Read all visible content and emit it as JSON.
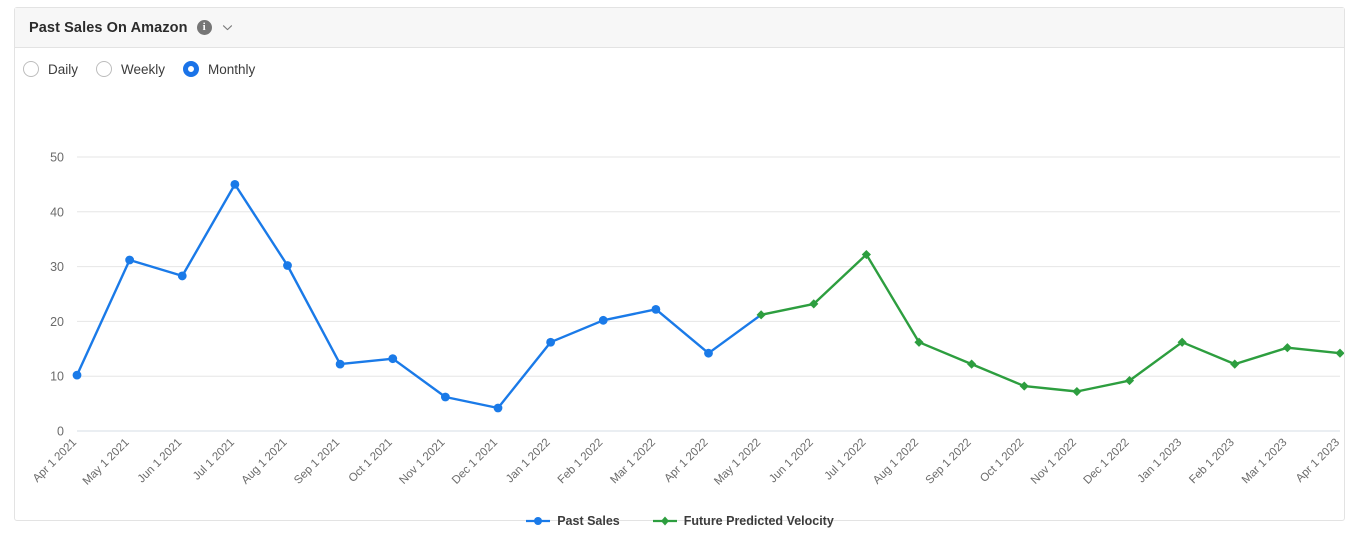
{
  "header": {
    "title": "Past Sales On Amazon",
    "info_icon": "info-icon",
    "info_glyph": "i",
    "chevron_icon": "chevron-down-icon"
  },
  "controls": {
    "granularity_options": [
      {
        "label": "Daily",
        "selected": false
      },
      {
        "label": "Weekly",
        "selected": false
      },
      {
        "label": "Monthly",
        "selected": true
      }
    ]
  },
  "colors": {
    "past_sales": "#1a7ae8",
    "future_velocity": "#2d9e3f",
    "grid": "#e6e6e6",
    "axis_text": "#6b6b6b",
    "card_border": "#e3e3e3",
    "header_bg": "#f7f7f7"
  },
  "chart_data": {
    "type": "line",
    "title": "Past Sales On Amazon",
    "xlabel": "",
    "ylabel": "",
    "ylim": [
      0,
      50
    ],
    "yticks": [
      0,
      10,
      20,
      30,
      40,
      50
    ],
    "grid": true,
    "legend_position": "bottom",
    "categories": [
      "Apr 1 2021",
      "May 1 2021",
      "Jun 1 2021",
      "Jul 1 2021",
      "Aug 1 2021",
      "Sep 1 2021",
      "Oct 1 2021",
      "Nov 1 2021",
      "Dec 1 2021",
      "Jan 1 2022",
      "Feb 1 2022",
      "Mar 1 2022",
      "Apr 1 2022",
      "May 1 2022",
      "Jun 1 2022",
      "Jul 1 2022",
      "Aug 1 2022",
      "Sep 1 2022",
      "Oct 1 2022",
      "Nov 1 2022",
      "Dec 1 2022",
      "Jan 1 2023",
      "Feb 1 2023",
      "Mar 1 2023",
      "Apr 1 2023"
    ],
    "series": [
      {
        "name": "Past Sales",
        "color": "#1a7ae8",
        "marker": "circle",
        "values": [
          10.2,
          31.2,
          28.3,
          45.0,
          30.2,
          12.2,
          13.2,
          6.2,
          4.2,
          16.2,
          20.2,
          22.2,
          14.2,
          null,
          null,
          null,
          null,
          null,
          null,
          null,
          null,
          null,
          null,
          null,
          null
        ]
      },
      {
        "name": "Future Predicted Velocity",
        "color": "#2d9e3f",
        "marker": "diamond",
        "values": [
          null,
          null,
          null,
          null,
          null,
          null,
          null,
          null,
          null,
          null,
          null,
          null,
          null,
          21.2,
          23.2,
          32.2,
          16.2,
          12.2,
          8.2,
          7.2,
          9.2,
          16.2,
          12.2,
          15.2,
          14.2
        ]
      }
    ]
  }
}
